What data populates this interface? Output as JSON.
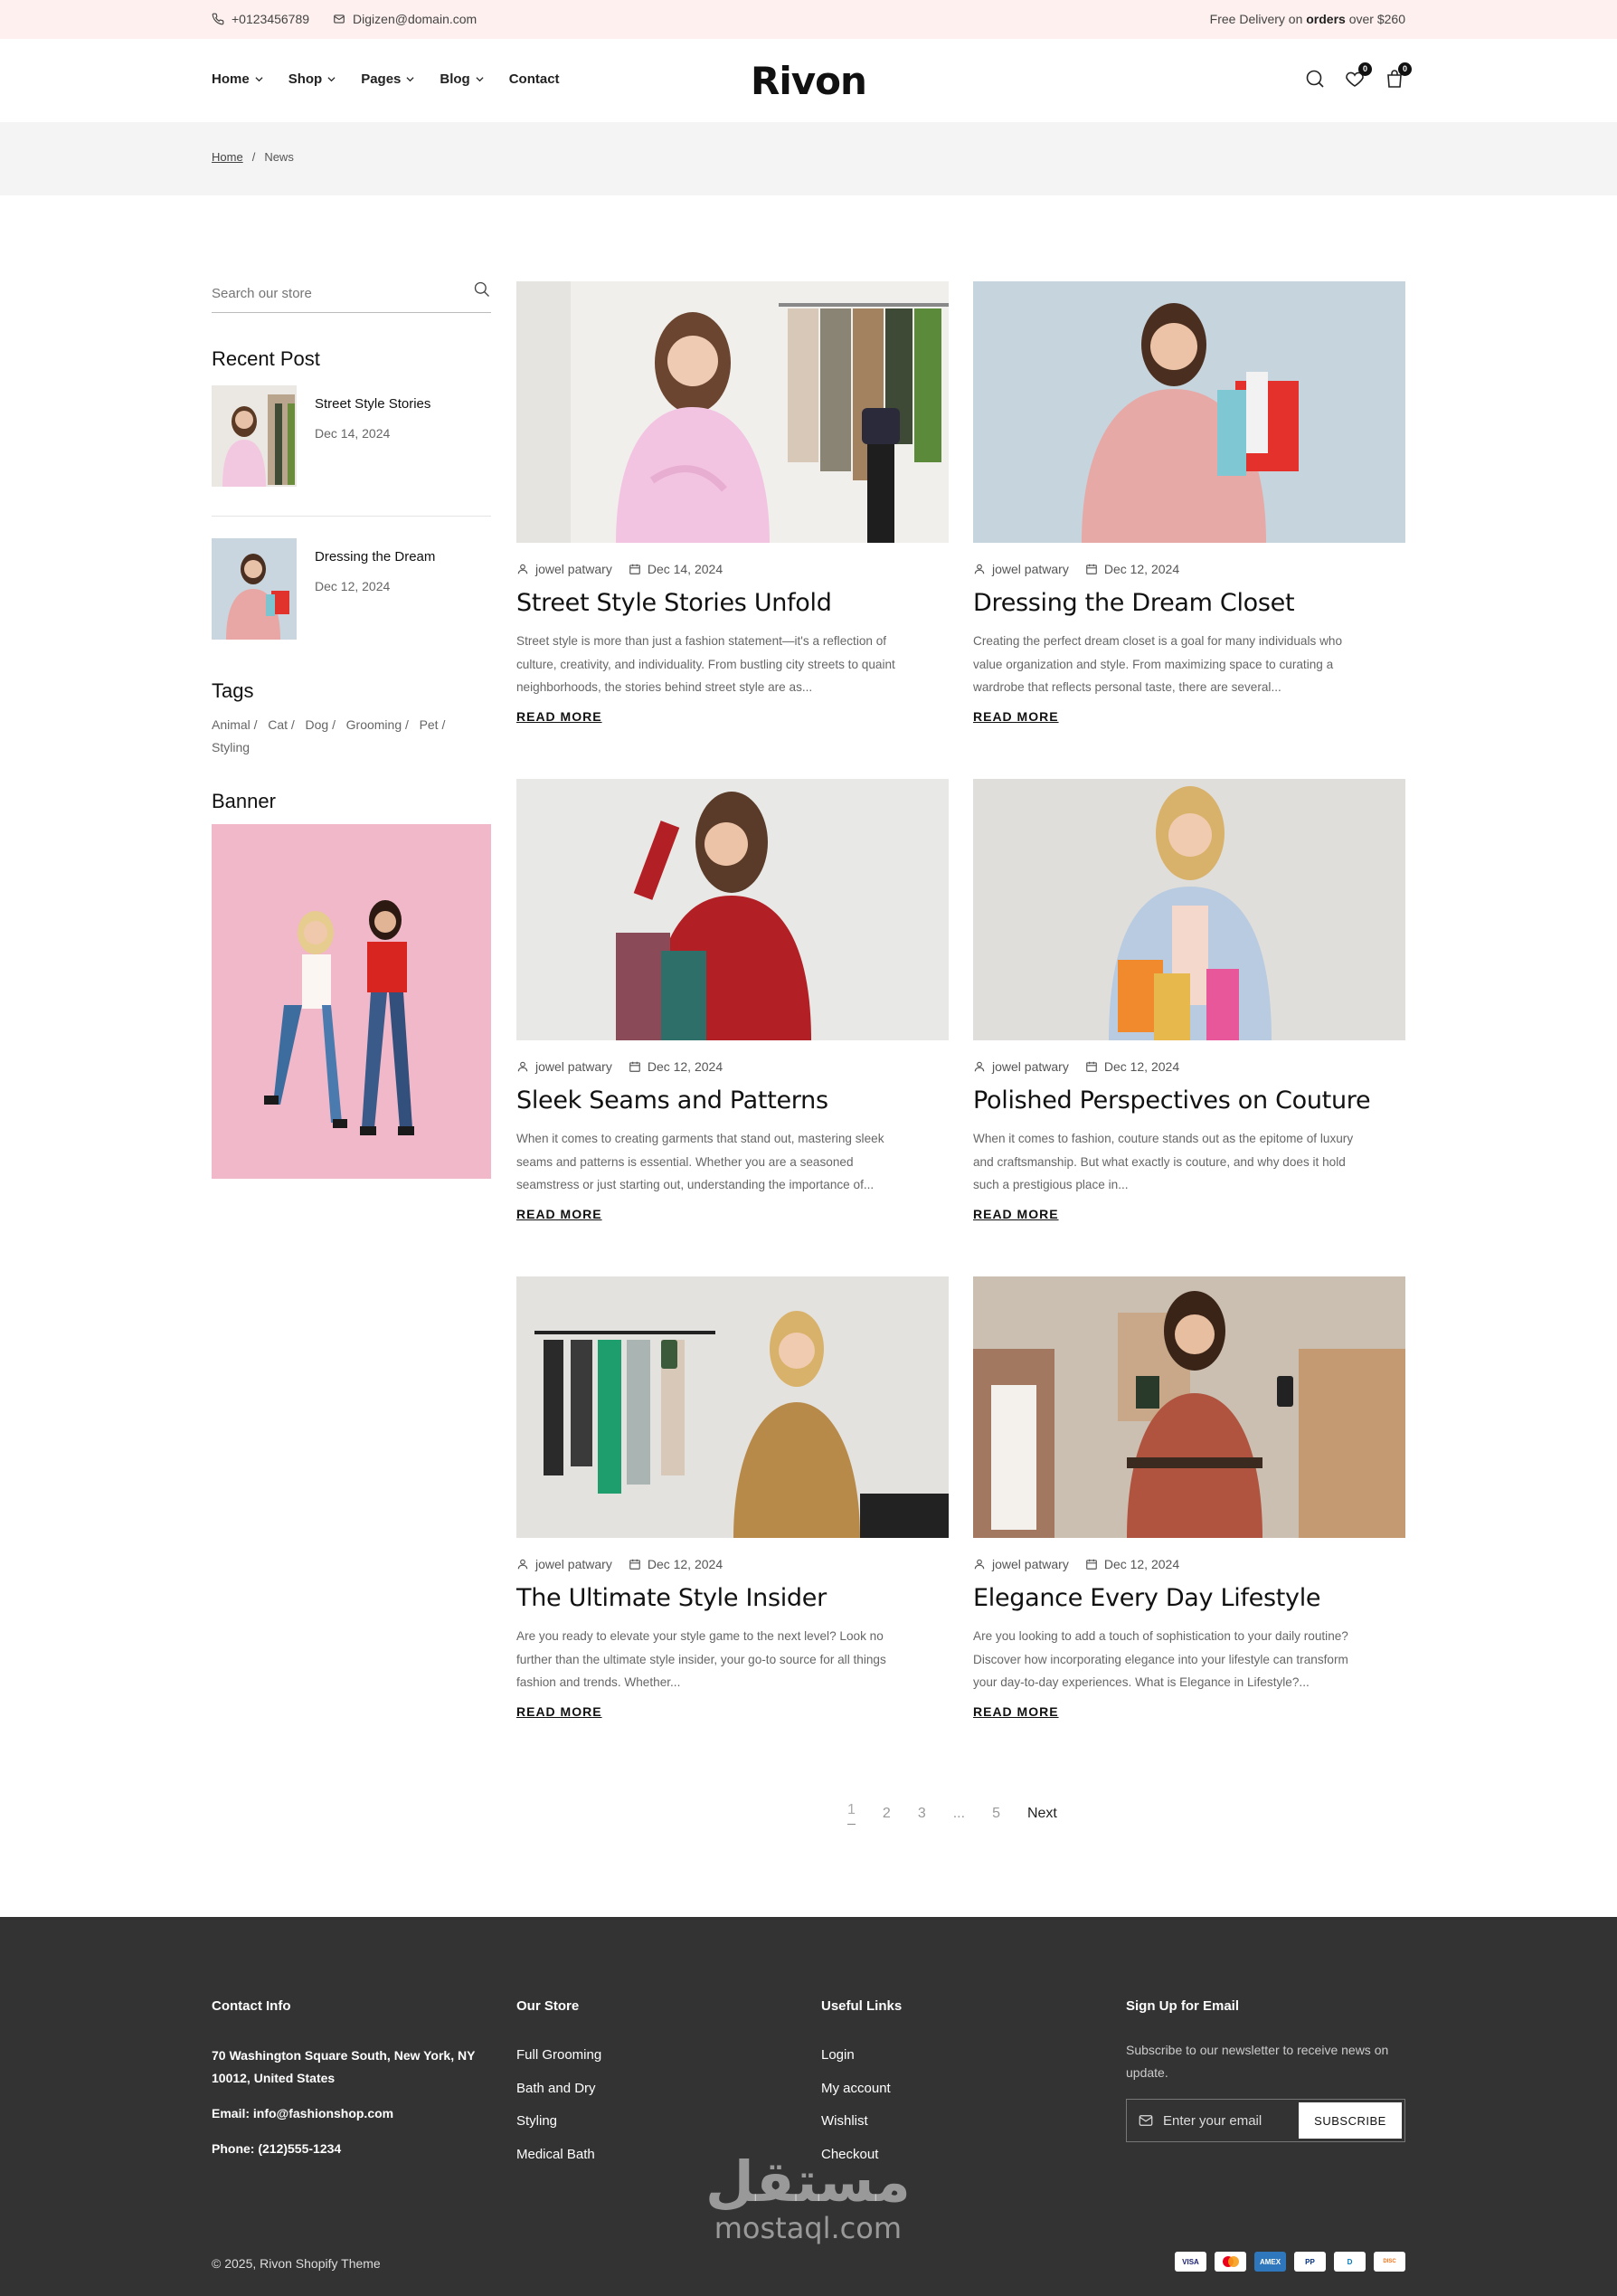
{
  "topbar": {
    "phone": "+0123456789",
    "email": "Digizen@domain.com",
    "delivery_pre": "Free Delivery on ",
    "delivery_bold": "orders",
    "delivery_post": " over $260"
  },
  "nav": [
    {
      "label": "Home"
    },
    {
      "label": "Shop"
    },
    {
      "label": "Pages"
    },
    {
      "label": "Blog"
    },
    {
      "label": "Contact"
    }
  ],
  "logo": "Rivon",
  "header": {
    "wishlist_count": "0",
    "cart_count": "0"
  },
  "breadcrumb": {
    "home": "Home",
    "sep": "/",
    "current": "News"
  },
  "sidebar": {
    "search_placeholder": "Search our store",
    "recent_title": "Recent Post",
    "recent": [
      {
        "title": "Street Style Stories",
        "date": "Dec 14, 2024"
      },
      {
        "title": "Dressing the Dream",
        "date": "Dec 12, 2024"
      }
    ],
    "tags_title": "Tags",
    "tags": [
      "Animal",
      "Cat",
      "Dog",
      "Grooming",
      "Pet",
      "Styling"
    ],
    "banner_title": "Banner"
  },
  "posts": [
    {
      "author": "jowel patwary",
      "date": "Dec 14, 2024",
      "title": "Street Style Stories Unfold",
      "excerpt": "Street style is more than just a fashion statement—it's a reflection of culture, creativity, and individuality. From bustling city streets to quaint neighborhoods, the stories behind street style are as...",
      "read_more": "READ MORE"
    },
    {
      "author": "jowel patwary",
      "date": "Dec 12, 2024",
      "title": "Dressing the Dream Closet",
      "excerpt": "Creating the perfect dream closet is a goal for many individuals who value organization and style. From maximizing space to curating a wardrobe that reflects personal taste, there are several...",
      "read_more": "READ MORE"
    },
    {
      "author": "jowel patwary",
      "date": "Dec 12, 2024",
      "title": "Sleek Seams and Patterns",
      "excerpt": "When it comes to creating garments that stand out, mastering sleek seams and patterns is essential. Whether you are a seasoned seamstress or just starting out, understanding the importance of...",
      "read_more": "READ MORE"
    },
    {
      "author": "jowel patwary",
      "date": "Dec 12, 2024",
      "title": "Polished Perspectives on Couture",
      "excerpt": "When it comes to fashion, couture stands out as the epitome of luxury and craftsmanship. But what exactly is couture, and why does it hold such a prestigious place in...",
      "read_more": "READ MORE"
    },
    {
      "author": "jowel patwary",
      "date": "Dec 12, 2024",
      "title": "The Ultimate Style Insider",
      "excerpt": "Are you ready to elevate your style game to the next level? Look no further than the ultimate style insider, your go-to source for all things fashion and trends. Whether...",
      "read_more": "READ MORE"
    },
    {
      "author": "jowel patwary",
      "date": "Dec 12, 2024",
      "title": "Elegance Every Day Lifestyle",
      "excerpt": "Are you looking to add a touch of sophistication to your daily routine? Discover how incorporating elegance into your lifestyle can transform your day-to-day experiences. What is Elegance in Lifestyle?...",
      "read_more": "READ MORE"
    }
  ],
  "pagination": {
    "pages": [
      "1",
      "2",
      "3",
      "...",
      "5"
    ],
    "next": "Next"
  },
  "footer": {
    "contact_title": "Contact Info",
    "address": "70 Washington Square South, New York, NY 10012, United States",
    "email": "Email: info@fashionshop.com",
    "phone": "Phone: (212)555-1234",
    "store_title": "Our Store",
    "store_links": [
      "Full Grooming",
      "Bath and Dry",
      "Styling",
      "Medical Bath"
    ],
    "useful_title": "Useful Links",
    "useful_links": [
      "Login",
      "My account",
      "Wishlist",
      "Checkout"
    ],
    "signup_title": "Sign Up for Email",
    "signup_text": "Subscribe to our newsletter to receive news on update.",
    "email_placeholder": "Enter your email",
    "subscribe": "SUBSCRIBE",
    "copyright": "© 2025, Rivon Shopify Theme",
    "payments": [
      "VISA",
      "MC",
      "AMEX",
      "PP",
      "D",
      "DISC"
    ]
  },
  "watermark": {
    "arabic": "مستقل",
    "latin": "mostaql.com"
  }
}
